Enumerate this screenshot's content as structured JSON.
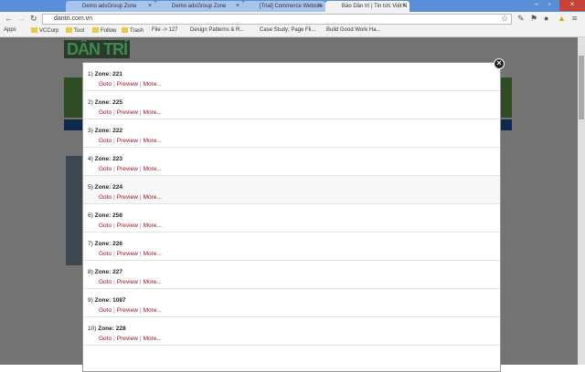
{
  "browser": {
    "tabs": [
      {
        "label": "Demo adsGroup Zone"
      },
      {
        "label": "Demo adsGroup Zone"
      },
      {
        "label": "[Trial] Commerce Website"
      },
      {
        "label": "Báo Dân trí | Tin tức Việt N"
      }
    ],
    "url": "dantri.com.vn",
    "bookmarks": [
      "Apps",
      "VCCorp",
      "Tool",
      "Follow",
      "Trash",
      "File -> 127",
      "Design Patterns & R...",
      "Case Study: Page Fli...",
      "Build Good Work Ha..."
    ]
  },
  "site": {
    "logo": "DÂN TRÍ"
  },
  "modal": {
    "items": [
      {
        "index": "1)",
        "zone": "Zone: 221"
      },
      {
        "index": "2)",
        "zone": "Zone: 225"
      },
      {
        "index": "3)",
        "zone": "Zone: 222"
      },
      {
        "index": "4)",
        "zone": "Zone: 223"
      },
      {
        "index": "5)",
        "zone": "Zone: 224"
      },
      {
        "index": "6)",
        "zone": "Zone: 256"
      },
      {
        "index": "7)",
        "zone": "Zone: 226"
      },
      {
        "index": "8)",
        "zone": "Zone: 227"
      },
      {
        "index": "9)",
        "zone": "Zone: 1087"
      },
      {
        "index": "10)",
        "zone": "Zone: 228"
      }
    ],
    "goto": "Goto",
    "preview": "Preview",
    "more": "More...",
    "sep": "|",
    "close": "×"
  }
}
